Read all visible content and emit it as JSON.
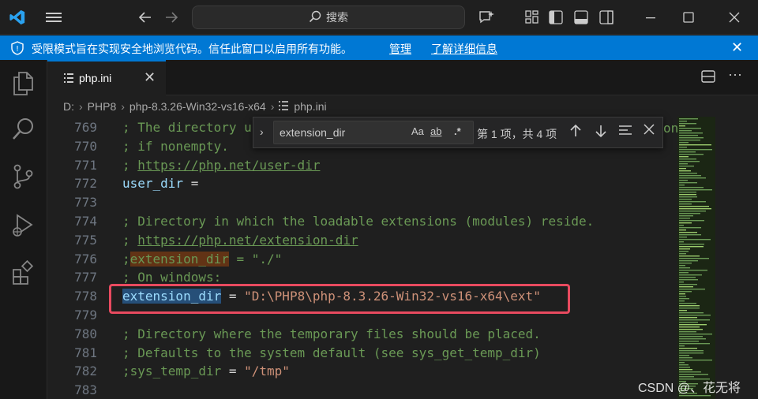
{
  "titlebar": {
    "search_label": "搜索"
  },
  "banner": {
    "message": "受限模式旨在实现安全地浏览代码。信任此窗口以启用所有功能。",
    "manage_link": "管理",
    "details_link": "了解详细信息"
  },
  "tab": {
    "name": "php.ini"
  },
  "breadcrumb": {
    "items": [
      "D:",
      "PHP8",
      "php-8.3.26-Win32-vs16-x64",
      "php.ini"
    ]
  },
  "find": {
    "query": "extension_dir",
    "match_case": "Aa",
    "whole_word": "ab",
    "regex": ".*",
    "count": "第 1 项，共 4 项"
  },
  "lines": [
    {
      "n": "769",
      "text": "; The directory u"
    },
    {
      "n": "770",
      "text": "; if nonempty."
    },
    {
      "n": "771",
      "text": "; ",
      "url": "https://php.net/user-dir"
    },
    {
      "n": "772",
      "text": "user_dir ="
    },
    {
      "n": "773",
      "text": ""
    },
    {
      "n": "774",
      "text": "; Directory in which the loadable extensions (modules) reside."
    },
    {
      "n": "775",
      "text": "; ",
      "url": "https://php.net/extension-dir"
    },
    {
      "n": "776",
      "text": ";extension_dir = \"./\""
    },
    {
      "n": "777",
      "text": "; On windows:"
    },
    {
      "n": "778",
      "text": "extension_dir = \"D:\\PHP8\\php-8.3.26-Win32-vs16-x64\\ext\""
    },
    {
      "n": "779",
      "text": ""
    },
    {
      "n": "780",
      "text": "; Directory where the temporary files should be placed."
    },
    {
      "n": "781",
      "text": "; Defaults to the system default (see sys_get_temp_dir)"
    },
    {
      "n": "782",
      "text": ";sys_temp_dir = \"/tmp\""
    },
    {
      "n": "783",
      "text": ""
    }
  ],
  "line_769_tail": "on",
  "watermark": "CSDN @、花无将",
  "colors": {
    "accent": "#0078d4",
    "highlight_box": "#e84a5f",
    "comment": "#6a9955",
    "string": "#ce9178",
    "keyword": "#9cdcfe"
  },
  "icons": [
    "vscode-logo-icon",
    "menu-icon",
    "back-arrow-icon",
    "forward-arrow-icon",
    "search-icon",
    "copilot-icon",
    "layout-icon",
    "sidebar-left-icon",
    "panel-icon",
    "sidebar-right-icon",
    "minimize-icon",
    "maximize-icon",
    "close-icon",
    "shield-icon",
    "explorer-icon",
    "search-view-icon",
    "source-control-icon",
    "run-debug-icon",
    "extensions-icon",
    "file-icon",
    "split-editor-icon",
    "more-actions-icon"
  ]
}
